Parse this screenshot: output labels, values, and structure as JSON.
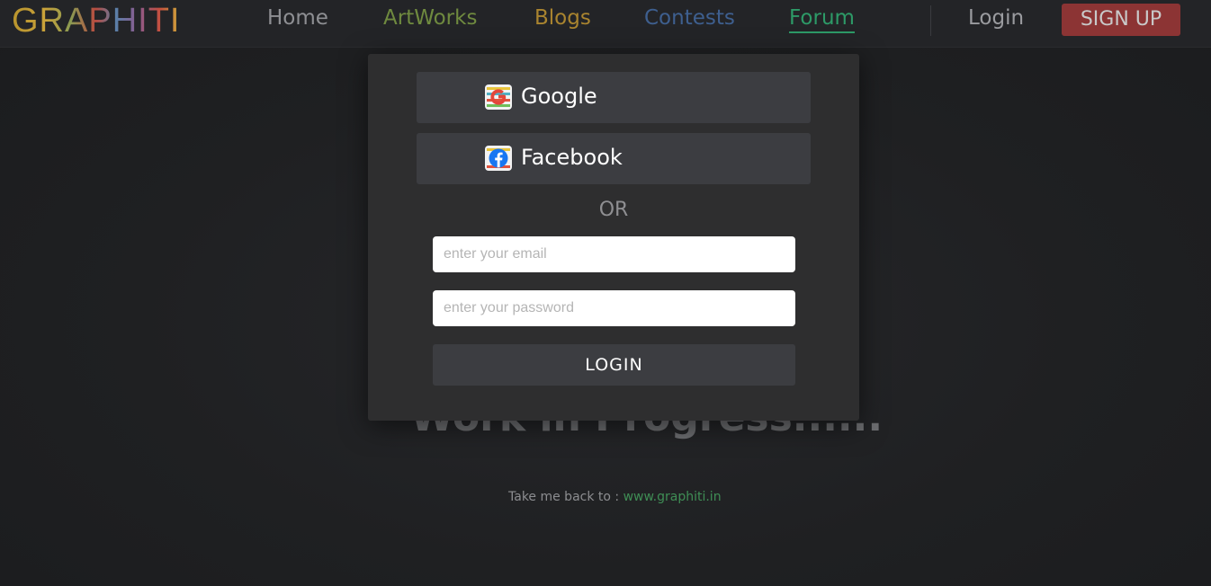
{
  "brand": {
    "logo_text": "GRAPHITI"
  },
  "nav": {
    "home": "Home",
    "artworks": "ArtWorks",
    "blogs": "Blogs",
    "contests": "Contests",
    "forum": "Forum",
    "login": "Login",
    "signup": "SIGN UP"
  },
  "background": {
    "wip_text": "Work in Progress......",
    "take_back_label": "Take me back to : ",
    "take_back_link": "www.graphiti.in"
  },
  "modal": {
    "google_label": "Google",
    "google_icon": "google-icon",
    "facebook_label": "Facebook",
    "facebook_icon": "facebook-icon",
    "or_text": "OR",
    "email_placeholder": "enter your email",
    "password_placeholder": "enter your password",
    "login_label": "LOGIN"
  },
  "colors": {
    "background": "#1e1f21",
    "navbar": "#232427",
    "modal": "#2e2e2f",
    "button": "#3c3d41",
    "signup": "#8c3434",
    "forum_active": "#2d9a67",
    "link_green": "#3f8e55"
  }
}
